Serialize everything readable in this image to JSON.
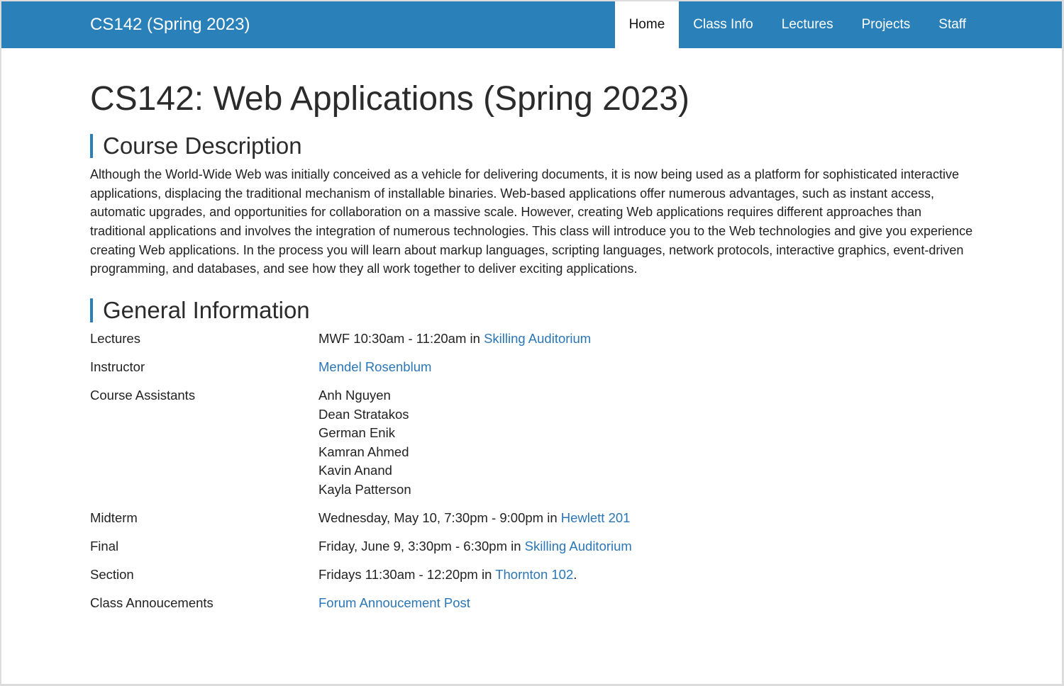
{
  "navbar": {
    "brand": "CS142 (Spring 2023)",
    "items": [
      {
        "label": "Home",
        "active": true
      },
      {
        "label": "Class Info",
        "active": false
      },
      {
        "label": "Lectures",
        "active": false
      },
      {
        "label": "Projects",
        "active": false
      },
      {
        "label": "Staff",
        "active": false
      }
    ],
    "color": "#2a80b9"
  },
  "page": {
    "title": "CS142: Web Applications (Spring 2023)",
    "description_heading": "Course Description",
    "description": "Although the World-Wide Web was initially conceived as a vehicle for delivering documents, it is now being used as a platform for sophisticated interactive applications, displacing the traditional mechanism of installable binaries. Web-based applications offer numerous advantages, such as instant access, automatic upgrades, and opportunities for collaboration on a massive scale. However, creating Web applications requires different approaches than traditional applications and involves the integration of numerous technologies. This class will introduce you to the Web technologies and give you experience creating Web applications. In the process you will learn about markup languages, scripting languages, network protocols, interactive graphics, event-driven programming, and databases, and see how they all work together to deliver exciting applications.",
    "general_heading": "General Information"
  },
  "info": {
    "lectures": {
      "label": "Lectures",
      "text": "MWF 10:30am - 11:20am in ",
      "link": "Skilling Auditorium"
    },
    "instructor": {
      "label": "Instructor",
      "link": "Mendel Rosenblum"
    },
    "assistants": {
      "label": "Course Assistants",
      "names": [
        "Anh Nguyen",
        "Dean Stratakos",
        "German Enik",
        "Kamran Ahmed",
        "Kavin Anand",
        "Kayla Patterson"
      ]
    },
    "midterm": {
      "label": "Midterm",
      "text": "Wednesday, May 10, 7:30pm - 9:00pm in ",
      "link": "Hewlett 201"
    },
    "final": {
      "label": "Final",
      "text": "Friday, June 9, 3:30pm - 6:30pm in ",
      "link": "Skilling Auditorium"
    },
    "section": {
      "label": "Section",
      "text": "Fridays 11:30am - 12:20pm in ",
      "link": "Thornton 102",
      "suffix": "."
    },
    "announcements": {
      "label": "Class Annoucements",
      "link": "Forum Annoucement Post"
    }
  }
}
